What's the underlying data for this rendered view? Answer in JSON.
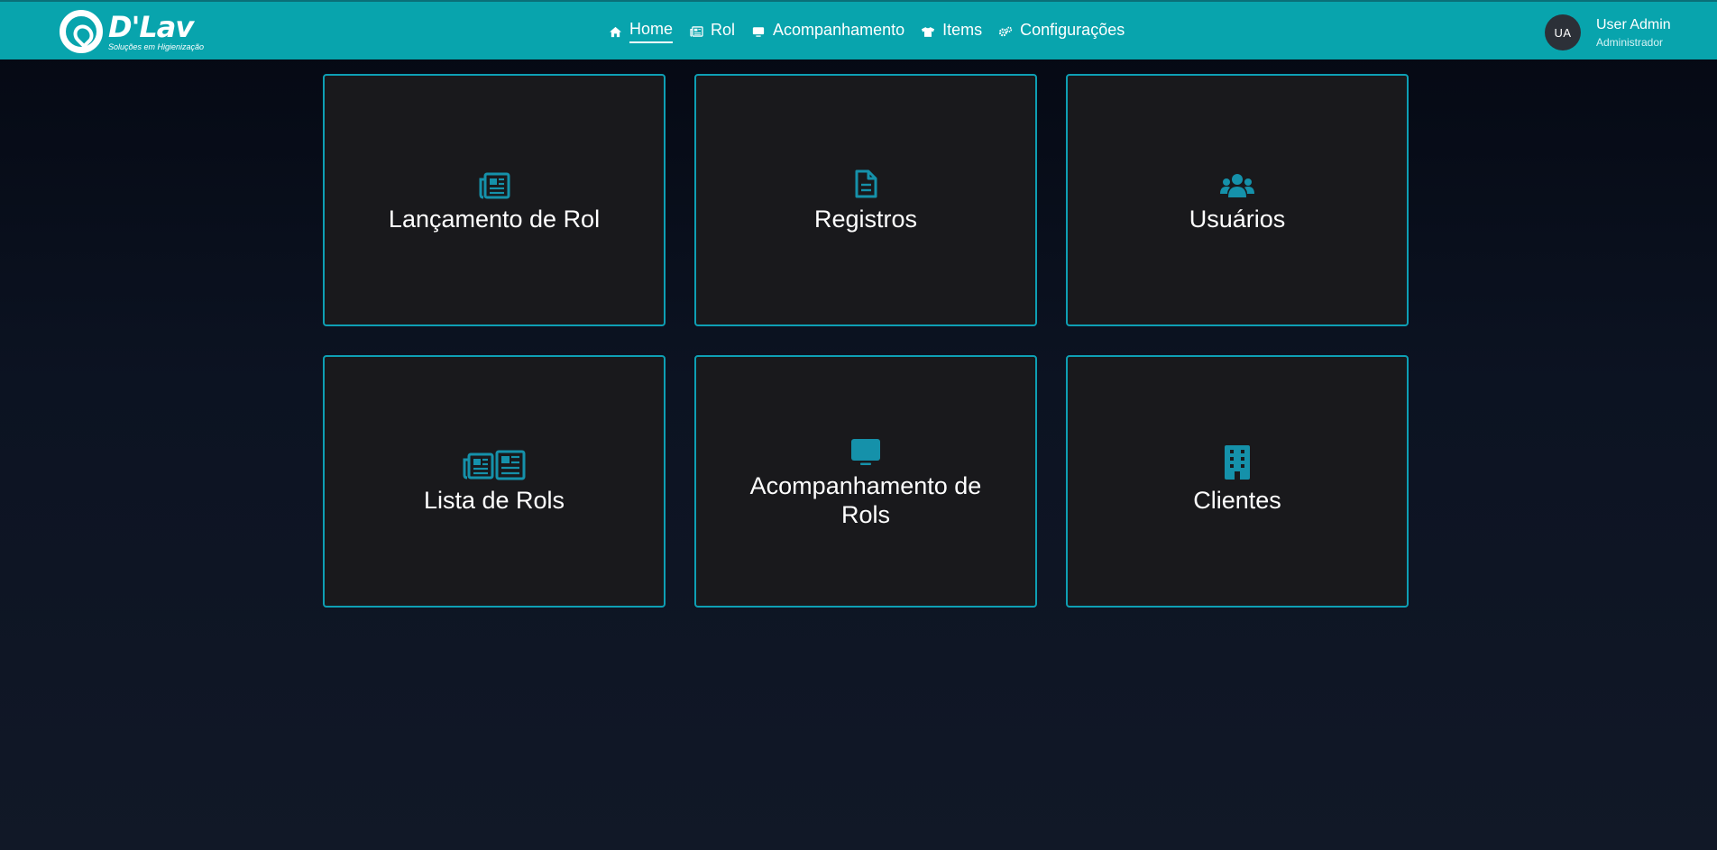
{
  "logo": {
    "name": "D'Lav",
    "tagline": "Soluções em Higienização"
  },
  "nav": {
    "home": "Home",
    "rol": "Rol",
    "acompanhamento": "Acompanhamento",
    "items": "Items",
    "configuracoes": "Configurações"
  },
  "user": {
    "initials": "UA",
    "name": "User Admin",
    "role": "Administrador"
  },
  "cards": [
    {
      "title": "Lançamento de Rol",
      "icon": "newspaper-icon"
    },
    {
      "title": "Registros",
      "icon": "file-lines-icon"
    },
    {
      "title": "Usuários",
      "icon": "users-icon"
    },
    {
      "title": "Lista de Rols",
      "icon": "newspapers-icon"
    },
    {
      "title": "Acompanhamento de Rols",
      "icon": "monitor-icon"
    },
    {
      "title": "Clientes",
      "icon": "building-icon"
    }
  ],
  "colors": {
    "topbar": "#08a4ad",
    "accent": "#0e9fb4",
    "card_bg": "#19191c"
  }
}
